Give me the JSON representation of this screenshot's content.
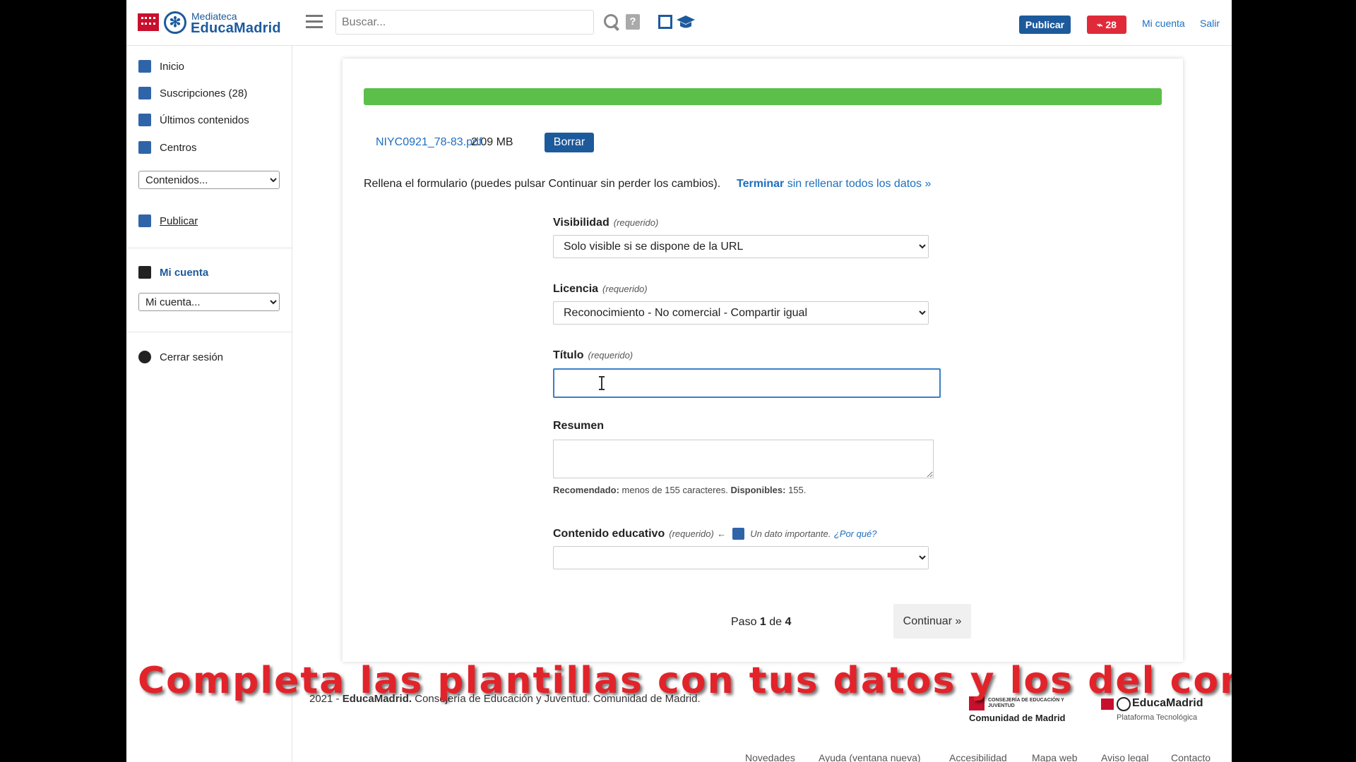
{
  "header": {
    "logo_small": "Mediateca",
    "logo_big": "EducaMadrid",
    "search_placeholder": "Buscar...",
    "publish_label": "Publicar",
    "rss_count": "28",
    "my_account": "Mi cuenta",
    "logout": "Salir",
    "colors": {
      "brand_blue": "#1d5a9c",
      "rss_red": "#e02a3a",
      "link": "#1d6fc0"
    }
  },
  "sidebar": {
    "items": [
      {
        "label": "Inicio",
        "icon": "home-icon"
      },
      {
        "label": "Suscripciones (28)",
        "icon": "rss-icon"
      },
      {
        "label": "Últimos contenidos",
        "icon": "clock-icon"
      },
      {
        "label": "Centros",
        "icon": "building-icon"
      }
    ],
    "contents_select": "Contenidos...",
    "publish": "Publicar",
    "account_title": "Mi cuenta",
    "account_select": "Mi cuenta...",
    "logout": "Cerrar sesión"
  },
  "upload": {
    "progress": 1.0,
    "file_name": "NIYC0921_78-83.pdf",
    "file_size": "2.09 MB",
    "delete_label": "Borrar"
  },
  "form": {
    "intro": "Rellena el formulario (puedes pulsar Continuar sin perder los cambios).",
    "finish_bold": "Terminar",
    "finish_rest": " sin rellenar todos los datos »",
    "required": "(requerido)",
    "visibility_label": "Visibilidad",
    "visibility_value": "Solo visible si se dispone de la URL",
    "license_label": "Licencia",
    "license_value": "Reconocimiento - No comercial - Compartir igual",
    "title_label": "Título",
    "title_value": "",
    "summary_label": "Resumen",
    "summary_hint_bold1": "Recomendado:",
    "summary_hint_text": " menos de 155 caracteres. ",
    "summary_hint_bold2": "Disponibles:",
    "summary_hint_count": " 155.",
    "edu_label": "Contenido educativo",
    "edu_arrow": "←",
    "edu_note": "Un dato importante.",
    "edu_why": "¿Por qué?",
    "edu_value": "",
    "step_prefix": "Paso ",
    "step_current": "1",
    "step_mid": " de ",
    "step_total": "4",
    "continue_label": "Continuar »"
  },
  "caption": "Completa las plantillas con tus datos y los del contenido",
  "footer": {
    "year": "2021 - ",
    "brand": "EducaMadrid.",
    "text": " Consejería de Educación y Juventud. Comunidad de Madrid.",
    "logo1_small": "CONSEJERÍA DE EDUCACIÓN Y JUVENTUD",
    "logo1_name": "Comunidad de Madrid",
    "logo2_name": "EducaMadrid",
    "logo2_sub": "Plataforma Tecnológica",
    "links": [
      "Novedades",
      "Ayuda (ventana nueva)",
      "Accesibilidad",
      "Mapa web",
      "Aviso legal",
      "Contacto"
    ]
  }
}
